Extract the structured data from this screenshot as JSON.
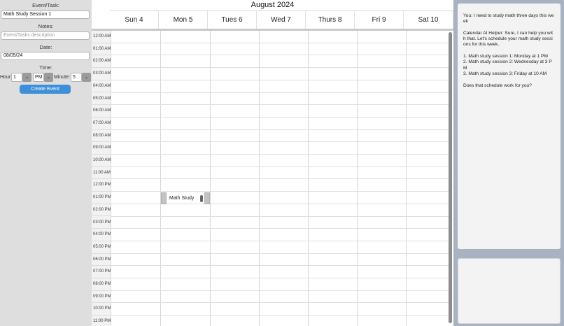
{
  "form": {
    "event_label": "Event/Task:",
    "event_value": "Math Study Session 1",
    "notes_label": "Notes:",
    "notes_placeholder": "Event/Tasks description",
    "date_label": "Date:",
    "date_value": "08/05/24",
    "time_label": "Time:",
    "hour_label": "Hour:",
    "hour_value": "1",
    "ampm_value": "PM",
    "minute_label": "Minute:",
    "minute_value": "5",
    "create_button": "Create Event"
  },
  "calendar": {
    "month_title": "August 2024",
    "days": [
      "Sun 4",
      "Mon 5",
      "Tues 6",
      "Wed 7",
      "Thurs 8",
      "Fri 9",
      "Sat 10"
    ],
    "times": [
      "12:00 AM",
      "01:00 AM",
      "02:00 AM",
      "03:00 AM",
      "04:00 AM",
      "05:00 AM",
      "06:00 AM",
      "07:00 AM",
      "08:00 AM",
      "09:00 AM",
      "10:00 AM",
      "11:00 AM",
      "12:00 PM",
      "01:00 PM",
      "02:00 PM",
      "03:00 PM",
      "04:00 PM",
      "05:00 PM",
      "06:00 PM",
      "07:00 PM",
      "08:00 PM",
      "09:00 PM",
      "10:00 PM",
      "11:00 PM"
    ],
    "event": {
      "label": "Math Study",
      "day": "Mon 5",
      "time": "01:00 PM"
    }
  },
  "chat": {
    "text": "You: I need to study math three days this week\n\nCalendar AI Helper: Sure, I can help you with that. Let's schedule your math study sessions for this week.\n\n1. Math study session 1: Monday at 1 PM\n2. Math study session 2: Wednesday at 3 PM\n3. Math study session 3: Friday at 10 AM\n\nDoes that schedule work for you?",
    "input_value": ""
  }
}
